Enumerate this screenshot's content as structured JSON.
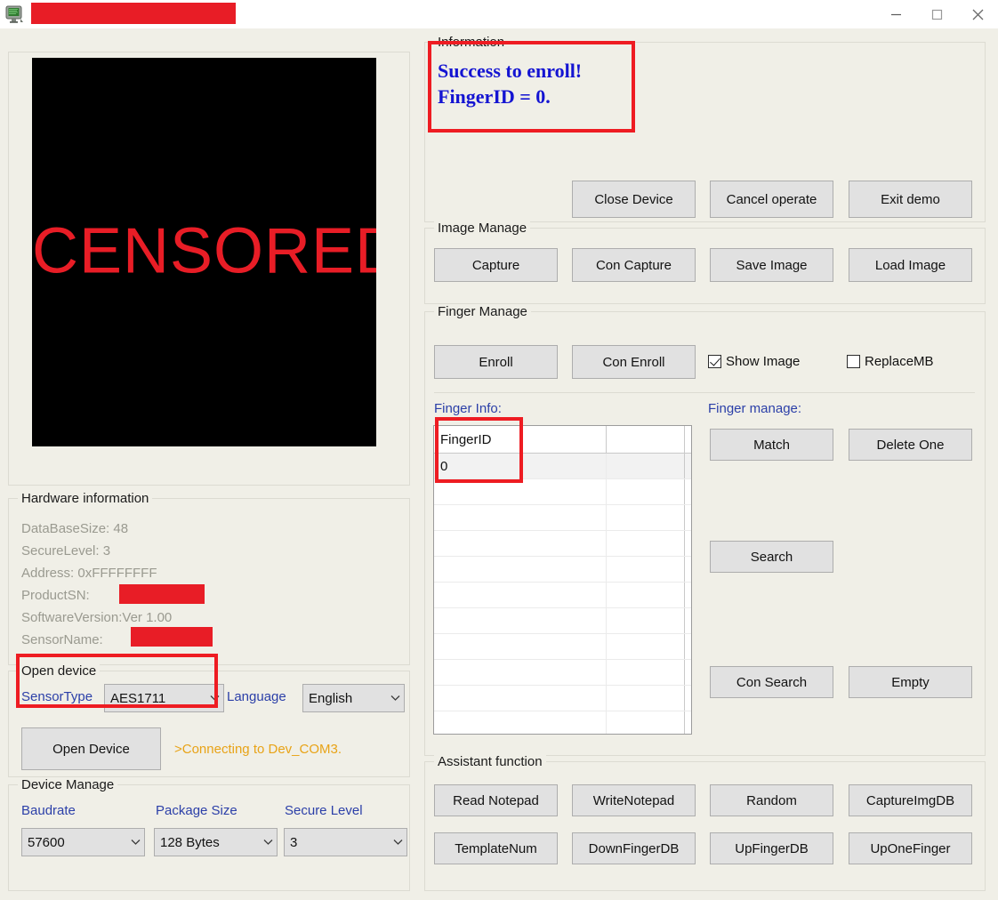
{
  "window": {
    "title_censored": true,
    "icon": "device-app-icon",
    "minimize_label": "Minimize",
    "maximize_label": "Maximize",
    "close_label": "Close"
  },
  "preview": {
    "overlay_text": "CENSORED"
  },
  "information": {
    "group_label": "Information",
    "line1": "Success to enroll!",
    "line2": "FingerID = 0.",
    "text_color": "#1414d2"
  },
  "device_actions": {
    "close_device": "Close Device",
    "cancel_operate": "Cancel operate",
    "exit_demo": "Exit demo"
  },
  "image_manage": {
    "group_label": "Image Manage",
    "capture": "Capture",
    "con_capture": "Con Capture",
    "save_image": "Save Image",
    "load_image": "Load Image"
  },
  "finger_manage": {
    "group_label": "Finger Manage",
    "enroll": "Enroll",
    "con_enroll": "Con Enroll",
    "show_image_label": "Show Image",
    "show_image_checked": true,
    "replacemb_label": "ReplaceMB",
    "replacemb_checked": false,
    "finger_info_label": "Finger Info:",
    "finger_manage_label": "Finger manage:",
    "match": "Match",
    "delete_one": "Delete One",
    "search": "Search",
    "con_search": "Con Search",
    "empty": "Empty"
  },
  "finger_table": {
    "columns": [
      "FingerID",
      "",
      ""
    ],
    "rows": [
      [
        "0",
        "",
        ""
      ],
      [
        "",
        "",
        ""
      ],
      [
        "",
        "",
        ""
      ],
      [
        "",
        "",
        ""
      ],
      [
        "",
        "",
        ""
      ],
      [
        "",
        "",
        ""
      ],
      [
        "",
        "",
        ""
      ],
      [
        "",
        "",
        ""
      ],
      [
        "",
        "",
        ""
      ],
      [
        "",
        "",
        ""
      ],
      [
        "",
        "",
        ""
      ]
    ]
  },
  "hardware": {
    "group_label": "Hardware information",
    "lines": [
      "DataBaseSize: 48",
      "SecureLevel:  3",
      "Address:   0xFFFFFFFF",
      "ProductSN:",
      "SoftwareVersion:Ver 1.00",
      "SensorName:"
    ]
  },
  "open_device": {
    "group_label": "Open device",
    "sensor_type_label": "SensorType",
    "sensor_type_value": "AES1711",
    "language_label": "Language",
    "language_value": "English",
    "open_device_button": "Open Device",
    "status_text": ">Connecting to Dev_COM3.",
    "status_color": "#e8a317"
  },
  "device_manage": {
    "group_label": "Device Manage",
    "baudrate_label": "Baudrate",
    "baudrate_value": "57600",
    "package_size_label": "Package Size",
    "package_size_value": "128 Bytes",
    "secure_level_label": "Secure Level",
    "secure_level_value": "3"
  },
  "assistant": {
    "group_label": "Assistant function",
    "read_notepad": "Read Notepad",
    "write_notepad": "WriteNotepad",
    "random": "Random",
    "capture_img_db": "CaptureImgDB",
    "template_num": "TemplateNum",
    "down_finger_db": "DownFingerDB",
    "up_finger_db": "UpFingerDB",
    "up_one_finger": "UpOneFinger"
  },
  "annotations": {
    "color": "#ee1c22",
    "boxes": [
      "information-panel",
      "fingerid-cell",
      "open-device-sensortype"
    ]
  }
}
